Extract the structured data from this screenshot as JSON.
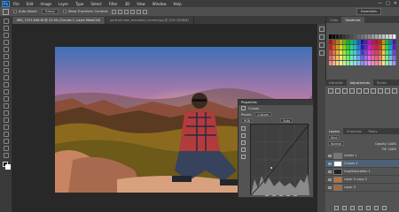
{
  "menu": {
    "logo": "Ps",
    "items": [
      "File",
      "Edit",
      "Image",
      "Layer",
      "Type",
      "Select",
      "Filter",
      "3D",
      "View",
      "Window",
      "Help"
    ],
    "window_controls": [
      "—",
      "□",
      "✕"
    ]
  },
  "options": {
    "auto_select": "Auto-Select",
    "target": "Group",
    "transform": "Show Transform Controls",
    "workspace": "Essentials"
  },
  "tabs": [
    {
      "label": "IMG_7251-Edit.tif @ 12.5% (Curves 1, Layer Mask/16)"
    },
    {
      "label": "portrait-man_mountain_sunset.jpg @ 25% (RGB/8)"
    }
  ],
  "color_panel": {
    "tabs": [
      "Color",
      "Swatches"
    ]
  },
  "adjust_panel": {
    "tabs": [
      "Libraries",
      "Adjustments",
      "Styles"
    ]
  },
  "properties": {
    "title": "Properties",
    "subtitle": "Curves",
    "preset_label": "Preset:",
    "preset_value": "Custom",
    "channel": "RGB",
    "auto": "Auto",
    "input_label": "Input:",
    "output_label": "Output:"
  },
  "layers_panel": {
    "tabs": [
      "Layers",
      "Channels",
      "Paths"
    ],
    "blend": "Normal",
    "opacity": "Opacity: 100%",
    "fill": "Fill: 100%",
    "kind": "Kind",
    "layers": [
      {
        "name": "Levels 1"
      },
      {
        "name": "Curves 1"
      },
      {
        "name": "Hue/Saturation 1"
      },
      {
        "name": "Layer 0 copy 2"
      },
      {
        "name": "Layer 0"
      }
    ]
  },
  "colors": {
    "accent": "#2d8cf0",
    "bg": "#535353",
    "dark": "#3a3a3a"
  }
}
